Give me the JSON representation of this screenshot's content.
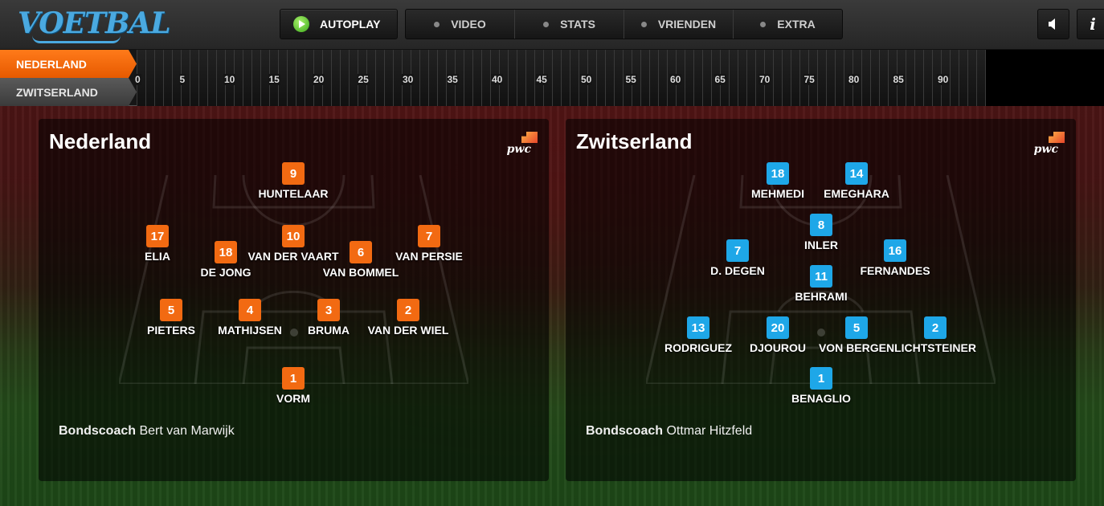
{
  "header": {
    "logo": "VOETBAL",
    "autoplay": "AUTOPLAY",
    "nav": [
      "VIDEO",
      "STATS",
      "VRIENDEN",
      "EXTRA"
    ],
    "info": "i"
  },
  "timeline": {
    "teams": [
      "NEDERLAND",
      "ZWITSERLAND"
    ],
    "ticks": [
      "0",
      "5",
      "10",
      "15",
      "20",
      "25",
      "30",
      "35",
      "40",
      "45",
      "50",
      "55",
      "60",
      "65",
      "70",
      "75",
      "80",
      "85",
      "90"
    ]
  },
  "teams": [
    {
      "name": "Nederland",
      "sponsor": "pwc",
      "coach_label": "Bondscoach",
      "coach": "Bert van Marwijk",
      "players": [
        {
          "num": "9",
          "name": "HUNTELAAR"
        },
        {
          "num": "17",
          "name": "ELIA"
        },
        {
          "num": "18",
          "name": "DE JONG"
        },
        {
          "num": "10",
          "name": "VAN DER VAART"
        },
        {
          "num": "6",
          "name": "VAN BOMMEL"
        },
        {
          "num": "7",
          "name": "VAN PERSIE"
        },
        {
          "num": "5",
          "name": "PIETERS"
        },
        {
          "num": "4",
          "name": "MATHIJSEN"
        },
        {
          "num": "3",
          "name": "BRUMA"
        },
        {
          "num": "2",
          "name": "VAN DER WIEL"
        },
        {
          "num": "1",
          "name": "VORM"
        }
      ]
    },
    {
      "name": "Zwitserland",
      "sponsor": "pwc",
      "coach_label": "Bondscoach",
      "coach": "Ottmar Hitzfeld",
      "players": [
        {
          "num": "18",
          "name": "MEHMEDI"
        },
        {
          "num": "14",
          "name": "EMEGHARA"
        },
        {
          "num": "8",
          "name": "INLER"
        },
        {
          "num": "7",
          "name": "D. DEGEN"
        },
        {
          "num": "16",
          "name": "FERNANDES"
        },
        {
          "num": "11",
          "name": "BEHRAMI"
        },
        {
          "num": "13",
          "name": "RODRIGUEZ"
        },
        {
          "num": "20",
          "name": "DJOUROU"
        },
        {
          "num": "5",
          "name": "VON BERGEN"
        },
        {
          "num": "2",
          "name": "LICHTSTEINER"
        },
        {
          "num": "1",
          "name": "BENAGLIO"
        }
      ]
    }
  ]
}
